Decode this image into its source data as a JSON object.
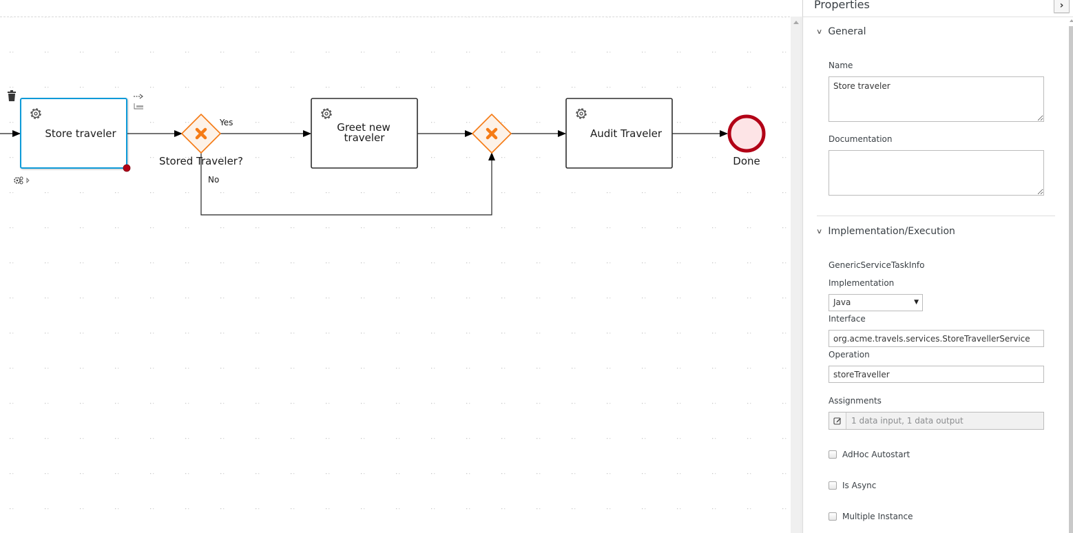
{
  "canvas": {
    "nodes": [
      {
        "id": "store-traveler",
        "type": "service-task",
        "label": "Store traveler",
        "selected": true
      },
      {
        "id": "stored-traveler-gateway",
        "type": "exclusive-gateway",
        "label": "Stored Traveler?"
      },
      {
        "id": "greet-new-traveler",
        "type": "service-task",
        "label_lines": [
          "Greet new",
          "traveler"
        ]
      },
      {
        "id": "merge-gateway",
        "type": "exclusive-gateway",
        "label": ""
      },
      {
        "id": "audit-traveler",
        "type": "service-task",
        "label": "Audit Traveler"
      },
      {
        "id": "done",
        "type": "end-event",
        "label": "Done"
      }
    ],
    "flows": [
      {
        "from": "start",
        "to": "store-traveler",
        "label": ""
      },
      {
        "from": "store-traveler",
        "to": "stored-traveler-gateway",
        "label": ""
      },
      {
        "from": "stored-traveler-gateway",
        "to": "greet-new-traveler",
        "label": "Yes"
      },
      {
        "from": "stored-traveler-gateway",
        "to": "merge-gateway",
        "label": "No"
      },
      {
        "from": "greet-new-traveler",
        "to": "merge-gateway",
        "label": ""
      },
      {
        "from": "merge-gateway",
        "to": "audit-traveler",
        "label": ""
      },
      {
        "from": "audit-traveler",
        "to": "done",
        "label": ""
      }
    ],
    "toolbox": {
      "delete_icon": "trash-icon",
      "connector_icon": "dashed-arrow-icon",
      "morph_icon": "task-morph-icon",
      "more_icon": "gears-icon"
    },
    "colors": {
      "selection": "#0f9ad8",
      "gateway_stroke": "#f57b15",
      "gateway_fill": "#fdf2e8",
      "end_stroke": "#b20016",
      "end_fill": "#fde4e6"
    }
  },
  "properties": {
    "title": "Properties",
    "collapse_icon": "chevron-right-icon",
    "general": {
      "heading": "General",
      "name_label": "Name",
      "name_value": "Store traveler",
      "documentation_label": "Documentation",
      "documentation_value": ""
    },
    "implementation": {
      "heading": "Implementation/Execution",
      "info_label": "GenericServiceTaskInfo",
      "implementation_label": "Implementation",
      "implementation_value": "Java",
      "interface_label": "Interface",
      "interface_value": "org.acme.travels.services.StoreTravellerService",
      "operation_label": "Operation",
      "operation_value": "storeTraveller",
      "assignments_label": "Assignments",
      "assignments_value": "1 data input, 1 data output",
      "checkboxes": [
        {
          "label": "AdHoc Autostart",
          "checked": false
        },
        {
          "label": "Is Async",
          "checked": false
        },
        {
          "label": "Multiple Instance",
          "checked": false
        }
      ]
    }
  }
}
